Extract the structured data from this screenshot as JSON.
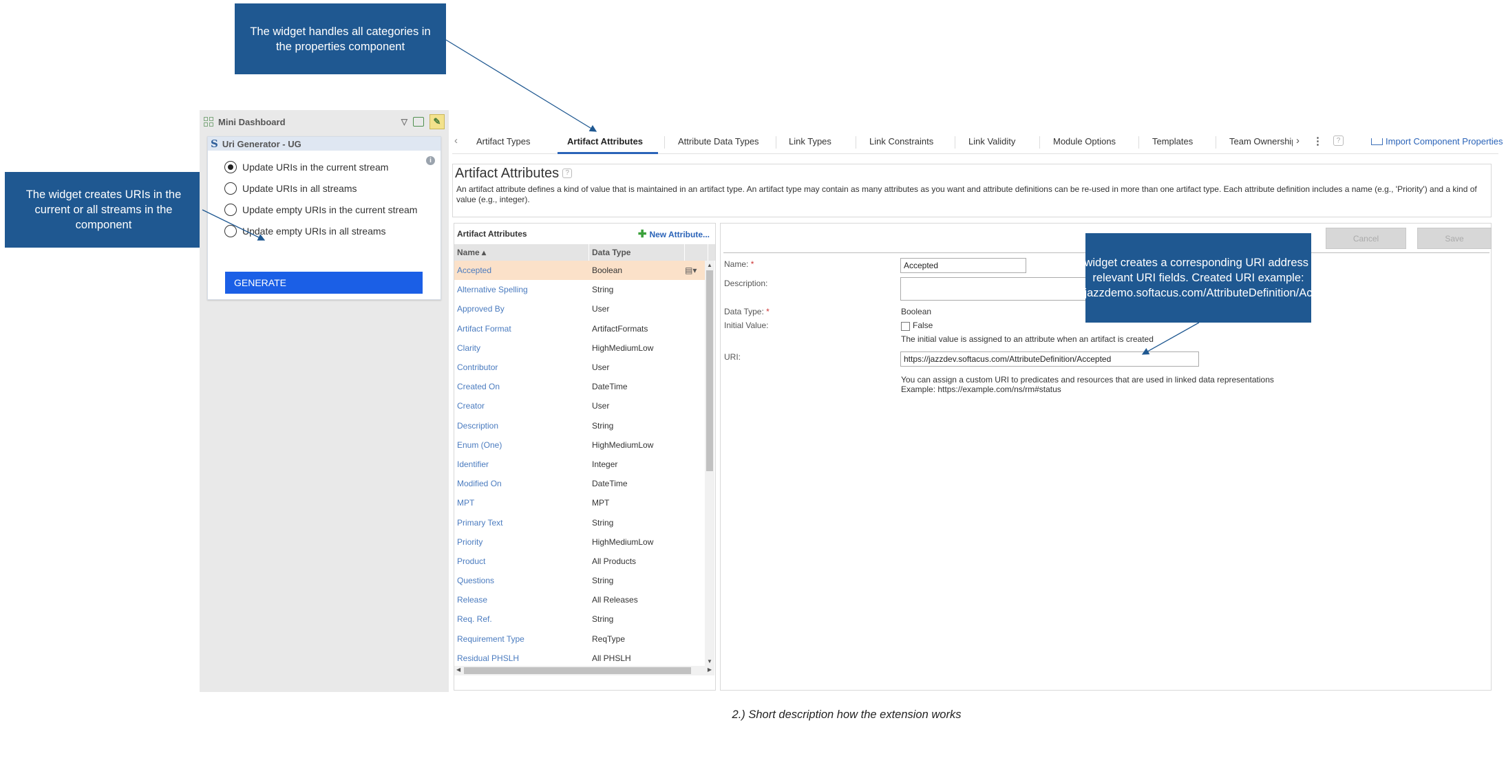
{
  "mini_dashboard": {
    "title": "Mini Dashboard",
    "widget_title": "Uri Generator - UG",
    "options": [
      {
        "label": "Update URIs in the current stream",
        "checked": true
      },
      {
        "label": "Update URIs in all streams",
        "checked": false
      },
      {
        "label": "Update empty URIs in the current stream",
        "checked": false
      },
      {
        "label": "Update empty URIs in all streams",
        "checked": false
      }
    ],
    "generate_label": "GENERATE"
  },
  "tabs": [
    {
      "label": "Artifact Types",
      "active": false
    },
    {
      "label": "Artifact Attributes",
      "active": true
    },
    {
      "label": "Attribute Data Types",
      "active": false
    },
    {
      "label": "Link Types",
      "active": false
    },
    {
      "label": "Link Constraints",
      "active": false
    },
    {
      "label": "Link Validity",
      "active": false
    },
    {
      "label": "Module Options",
      "active": false
    },
    {
      "label": "Templates",
      "active": false
    },
    {
      "label": "Team Ownership",
      "active": false
    }
  ],
  "import_label": "Import Component Properties",
  "section": {
    "title": "Artifact Attributes",
    "description": "An artifact attribute defines a kind of value that is maintained in an artifact type. An artifact type may contain as many attributes as you want and attribute definitions can be re-used in more than one artifact type. Each attribute definition includes a name (e.g., 'Priority') and a kind of value (e.g., integer)."
  },
  "attributes_panel": {
    "title": "Artifact Attributes",
    "new_label": "New Attribute...",
    "columns": [
      "Name ▴",
      "Data Type"
    ],
    "rows": [
      {
        "name": "Accepted",
        "type": "Boolean",
        "selected": true
      },
      {
        "name": "Alternative Spelling",
        "type": "String"
      },
      {
        "name": "Approved By",
        "type": "User"
      },
      {
        "name": "Artifact Format",
        "type": "ArtifactFormats"
      },
      {
        "name": "Clarity",
        "type": "HighMediumLow"
      },
      {
        "name": "Contributor",
        "type": "User"
      },
      {
        "name": "Created On",
        "type": "DateTime"
      },
      {
        "name": "Creator",
        "type": "User"
      },
      {
        "name": "Description",
        "type": "String"
      },
      {
        "name": "Enum (One)",
        "type": "HighMediumLow"
      },
      {
        "name": "Identifier",
        "type": "Integer"
      },
      {
        "name": "Modified On",
        "type": "DateTime"
      },
      {
        "name": "MPT",
        "type": "MPT"
      },
      {
        "name": "Primary Text",
        "type": "String"
      },
      {
        "name": "Priority",
        "type": "HighMediumLow"
      },
      {
        "name": "Product",
        "type": "All Products"
      },
      {
        "name": "Questions",
        "type": "String"
      },
      {
        "name": "Release",
        "type": "All Releases"
      },
      {
        "name": "Req. Ref.",
        "type": "String"
      },
      {
        "name": "Requirement Type",
        "type": "ReqType"
      },
      {
        "name": "Residual PHSLH",
        "type": "All PHSLH"
      }
    ]
  },
  "detail": {
    "cancel_label": "Cancel",
    "save_label": "Save",
    "name_label": "Name:",
    "name_value": "Accepted",
    "description_label": "Description:",
    "description_value": "",
    "data_type_label": "Data Type:",
    "data_type_value": "Boolean",
    "initial_value_label": "Initial Value:",
    "initial_value_option": "False",
    "initial_value_hint": "The initial value is assigned to an attribute when an artifact is created",
    "uri_label": "URI:",
    "uri_value": "https://jazzdev.softacus.com/AttributeDefinition/Accepted",
    "uri_hint_1": "You can assign a custom URI to predicates and resources that are used in linked data representations",
    "uri_hint_2": "Example: https://example.com/ns/rm#status"
  },
  "callouts": {
    "tabs": "The widget handles all categories in the properties component",
    "streams": "The widget creates URIs in the current or all streams in the component",
    "uri": "The widget creates a corresponding URI address in all relevant URI fields. Created URI example: https://jazzdemo.softacus.com/AttributeDefinition/Accepted"
  },
  "caption": "2.) Short description how the extension works",
  "colors": {
    "callout_bg": "#1f5891",
    "generate_bg": "#1b5fe6",
    "link_blue": "#2a63b8",
    "selected_row": "#fbe1c9"
  }
}
